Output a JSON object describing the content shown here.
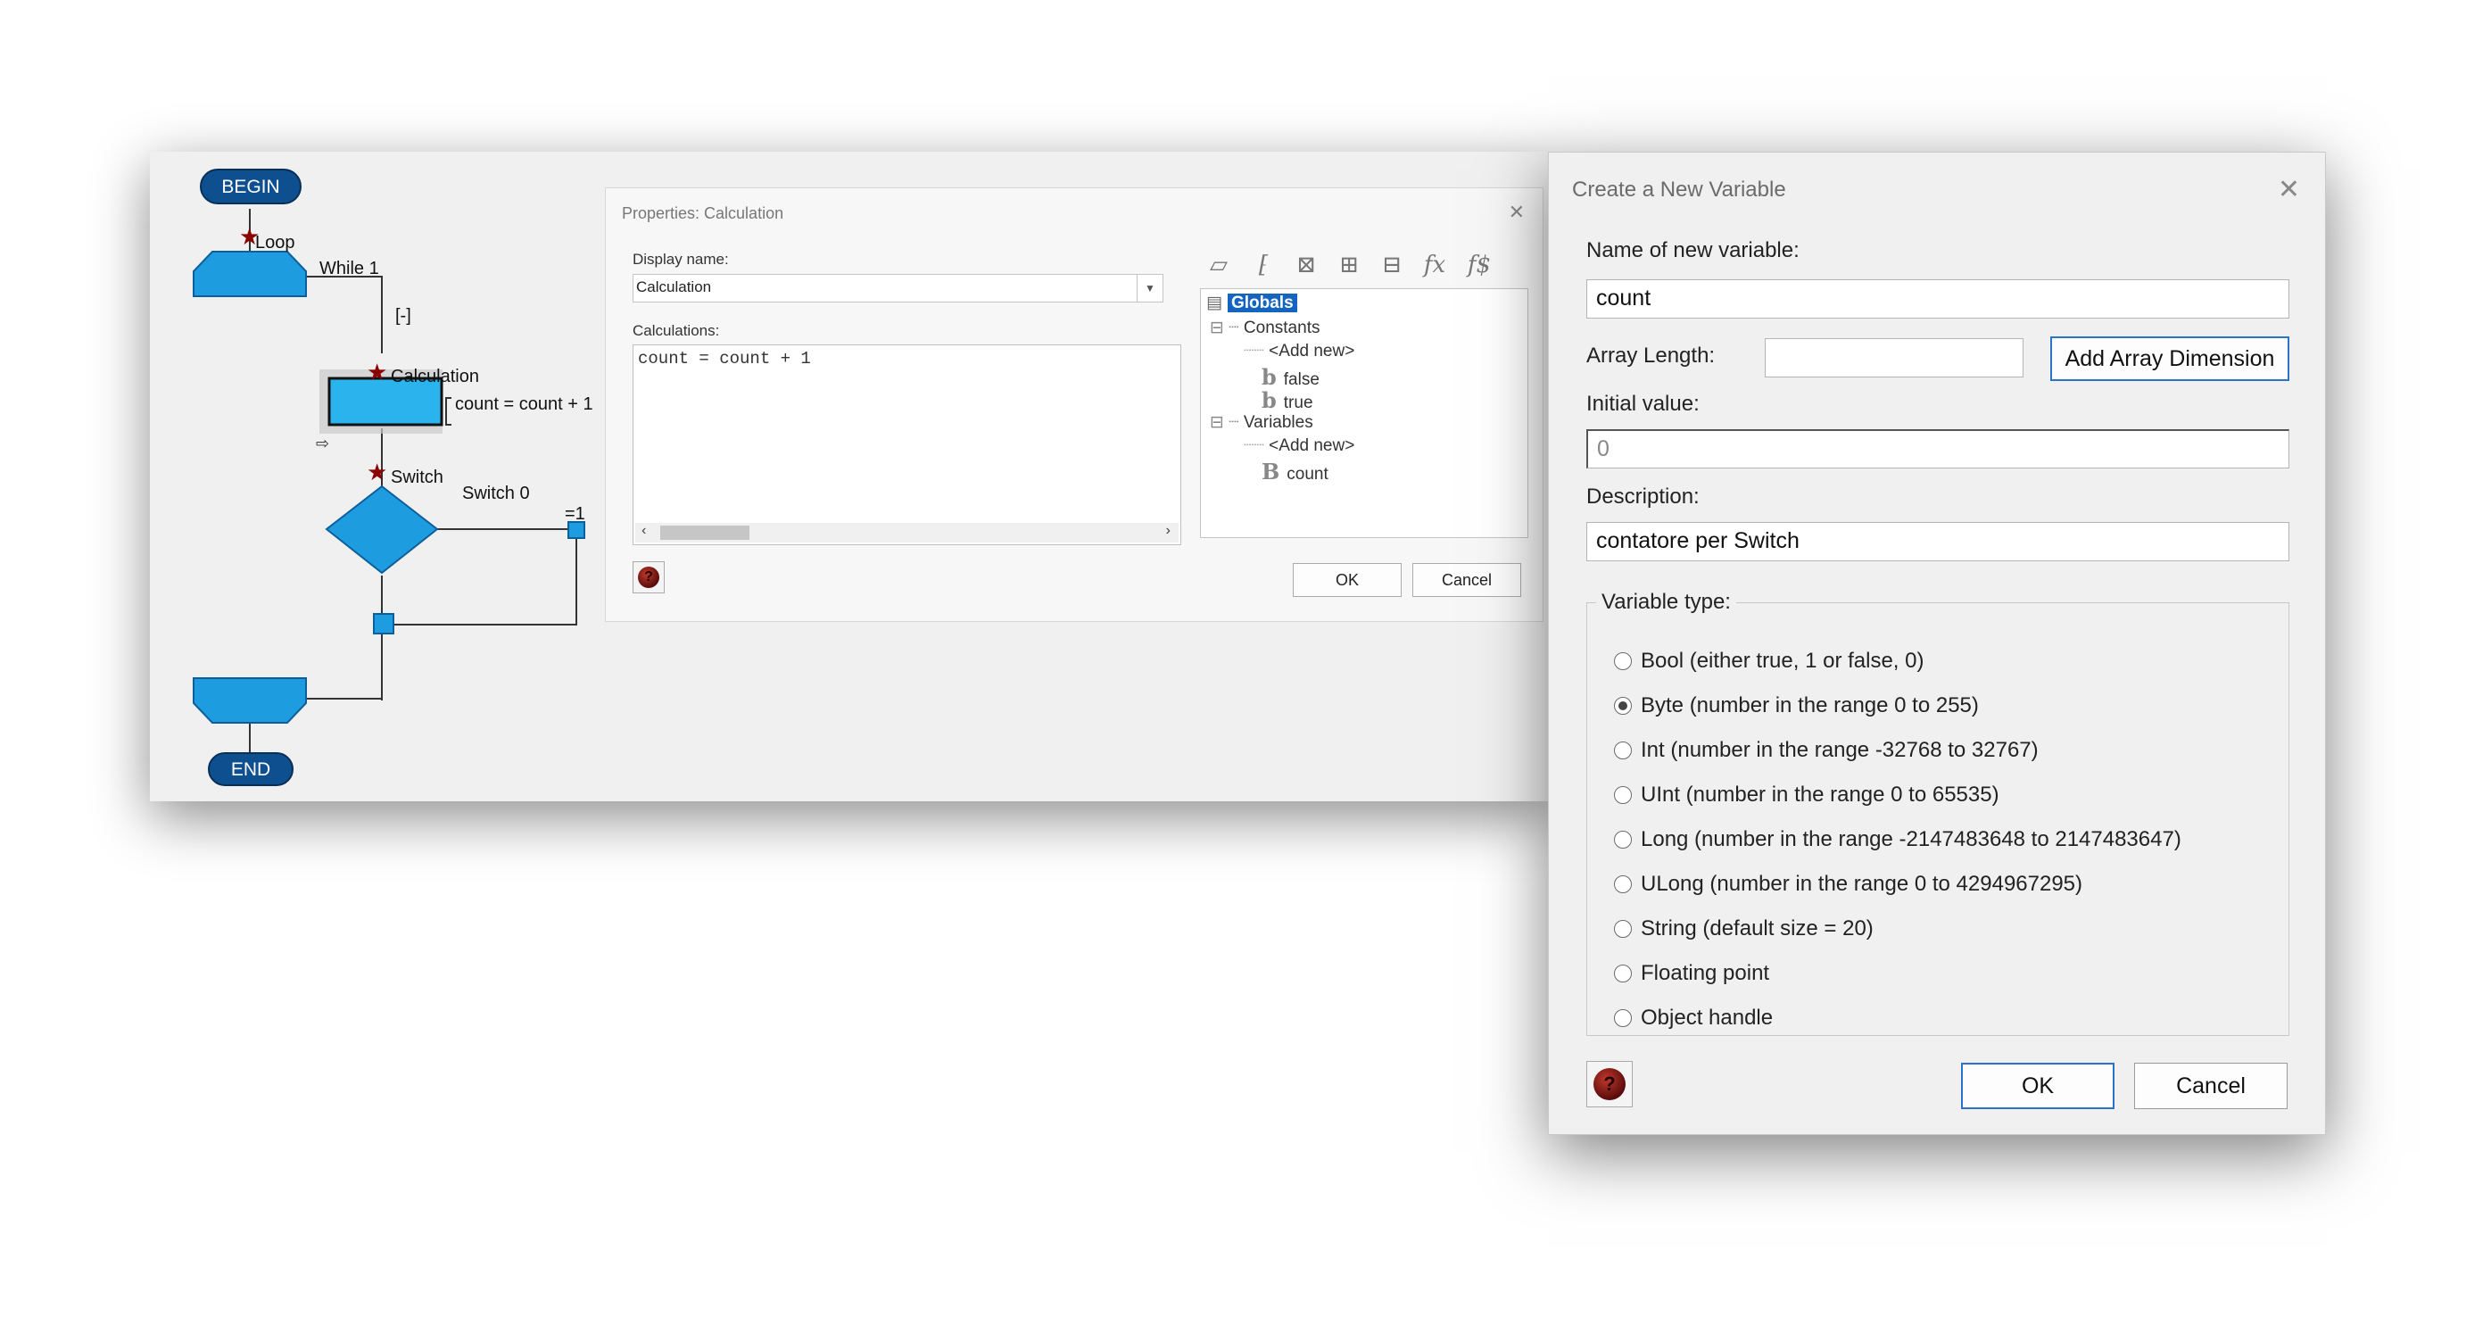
{
  "flowchart": {
    "begin_label": "BEGIN",
    "end_label": "END",
    "loop_label": "Loop",
    "loop_condition": "While 1",
    "collapse_marker": "[-]",
    "calc_label": "Calculation",
    "calc_expression": "count = count + 1",
    "switch_label": "Switch",
    "switch_value": "Switch 0",
    "switch_case": "=1"
  },
  "properties_dialog": {
    "title": "Properties: Calculation",
    "display_name_label": "Display name:",
    "display_name_value": "Calculation",
    "calculations_label": "Calculations:",
    "calculations_code": "count = count + 1",
    "tree": {
      "root": "Globals",
      "constants_label": "Constants",
      "constants_add": "<Add new>",
      "constants": [
        "false",
        "true"
      ],
      "variables_label": "Variables",
      "variables_add": "<Add new>",
      "variables": [
        "count"
      ]
    },
    "ok_label": "OK",
    "cancel_label": "Cancel"
  },
  "new_variable_dialog": {
    "title": "Create a New Variable",
    "name_label": "Name of new variable:",
    "name_value": "count",
    "array_length_label": "Array Length:",
    "array_length_value": "",
    "add_array_button": "Add Array Dimension",
    "initial_value_label": "Initial value:",
    "initial_value": "0",
    "description_label": "Description:",
    "description_value": "contatore per Switch",
    "variable_type_label": "Variable type:",
    "types": [
      {
        "label": "Bool (either true, 1 or false, 0)",
        "selected": false
      },
      {
        "label": "Byte (number in the range 0 to 255)",
        "selected": true
      },
      {
        "label": "Int (number in the range -32768 to 32767)",
        "selected": false
      },
      {
        "label": "UInt (number in the range 0 to 65535)",
        "selected": false
      },
      {
        "label": "Long (number in the range -2147483648 to 2147483647)",
        "selected": false
      },
      {
        "label": "ULong (number in the range 0 to 4294967295)",
        "selected": false
      },
      {
        "label": "String (default size = 20)",
        "selected": false
      },
      {
        "label": "Floating point",
        "selected": false
      },
      {
        "label": "Object handle",
        "selected": false
      }
    ],
    "ok_label": "OK",
    "cancel_label": "Cancel"
  },
  "colors": {
    "flow_blue": "#1e9ce0",
    "terminal_blue": "#0d4f8f",
    "selection_blue": "#1565c0"
  }
}
